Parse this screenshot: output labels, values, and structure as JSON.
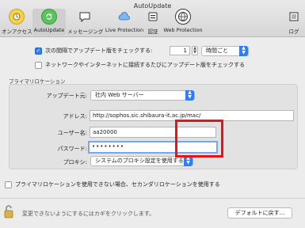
{
  "window": {
    "title": "AutoUpdate"
  },
  "toolbar": {
    "items": [
      {
        "label": "オンアクセス",
        "icon": "on-access-icon"
      },
      {
        "label": "AutoUpdate",
        "icon": "autoupdate-icon"
      },
      {
        "label": "メッセージング",
        "icon": "messaging-icon"
      },
      {
        "label": "Live Protection",
        "icon": "live-protection-icon"
      },
      {
        "label": "認証",
        "icon": "auth-icon"
      },
      {
        "label": "Web Protection",
        "icon": "web-protection-icon"
      },
      {
        "label": "ログ",
        "icon": "log-icon"
      }
    ]
  },
  "schedule": {
    "check_label": "次の間隔でアップデート版をチェックする:",
    "interval_value": "1",
    "interval_unit": "時間ごと",
    "network_check_label": "ネットワークやインターネットに接続するたびにアップデート版をチェックする"
  },
  "primary": {
    "section_title": "プライマリロケーション",
    "source_label": "アップデート元:",
    "source_value": "社内 Web サーバー",
    "address_label": "アドレス:",
    "address_value": "http://sophos.sic.shibaura-it.ac.jp/mac/",
    "username_label": "ユーザー名:",
    "username_value": "aa20000",
    "password_label": "パスワード:",
    "password_value": "••••••••",
    "proxy_label": "プロキシ:",
    "proxy_value": "システムのプロキシ設定を使用する"
  },
  "secondary": {
    "label": "プライマリロケーションを使用できない場合、セカンダリロケーションを使用する"
  },
  "footer": {
    "lock_text": "変更できないようにするにはカギをクリックします。",
    "default_button": "デフォルトに戻す..."
  },
  "colors": {
    "accent": "#2f7cf6",
    "highlight": "#e3141c"
  }
}
